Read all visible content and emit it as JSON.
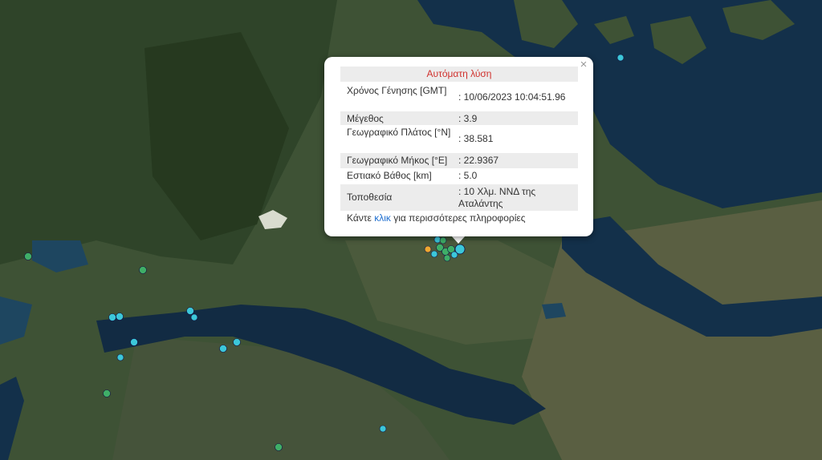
{
  "popup": {
    "title": "Αυτόματη λύση",
    "close_symbol": "×",
    "rows": [
      {
        "label": "Χρόνος Γένησης [GMT]",
        "value": ": 10/06/2023 10:04:51.96"
      },
      {
        "label": "Μέγεθος",
        "value": ": 3.9"
      },
      {
        "label": "Γεωγραφικό Πλάτος [°N]",
        "value": ": 38.581"
      },
      {
        "label": "Γεωγραφικό Μήκος [°E]",
        "value": ": 22.9367"
      },
      {
        "label": "Εστιακό Βάθος [km]",
        "value": ": 5.0"
      },
      {
        "label": "Τοποθεσία",
        "value": ": 10 Χλμ. ΝΝΔ της Αταλάντης"
      }
    ],
    "footer_before": "Κάντε ",
    "footer_link": "κλικ",
    "footer_after": " για περισσότερες πληροφορίες"
  },
  "colors": {
    "marker_green": "#3fae67",
    "marker_cyan": "#3cc7d9",
    "marker_orange": "#f0a830",
    "title_red": "#d0312d",
    "link_blue": "#1f6fd0"
  }
}
